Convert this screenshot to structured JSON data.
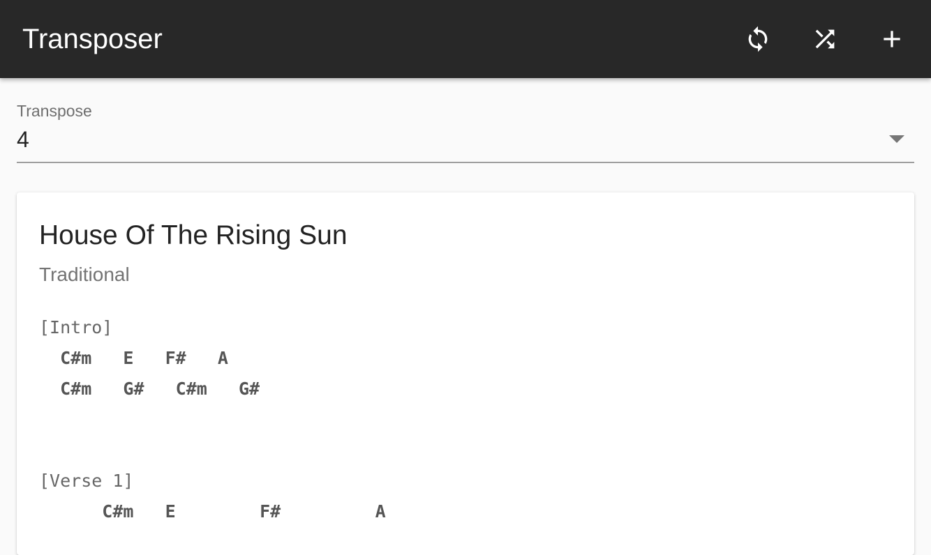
{
  "app": {
    "title": "Transposer",
    "accent_bg": "#282828",
    "actions": [
      {
        "name": "sync-icon",
        "label": "Reset"
      },
      {
        "name": "shuffle-icon",
        "label": "Shuffle"
      },
      {
        "name": "add-icon",
        "label": "Add"
      }
    ]
  },
  "transpose": {
    "label": "Transpose",
    "value": "4"
  },
  "song": {
    "title": "House Of The Rising Sun",
    "artist": "Traditional",
    "lines": [
      {
        "type": "section",
        "text": "[Intro]"
      },
      {
        "type": "chords",
        "text": "  C#m   E   F#   A"
      },
      {
        "type": "chords",
        "text": "  C#m   G#   C#m   G#"
      },
      {
        "type": "blank",
        "text": ""
      },
      {
        "type": "blank",
        "text": ""
      },
      {
        "type": "section",
        "text": "[Verse 1]"
      },
      {
        "type": "chords",
        "text": "      C#m   E        F#         A"
      }
    ]
  }
}
